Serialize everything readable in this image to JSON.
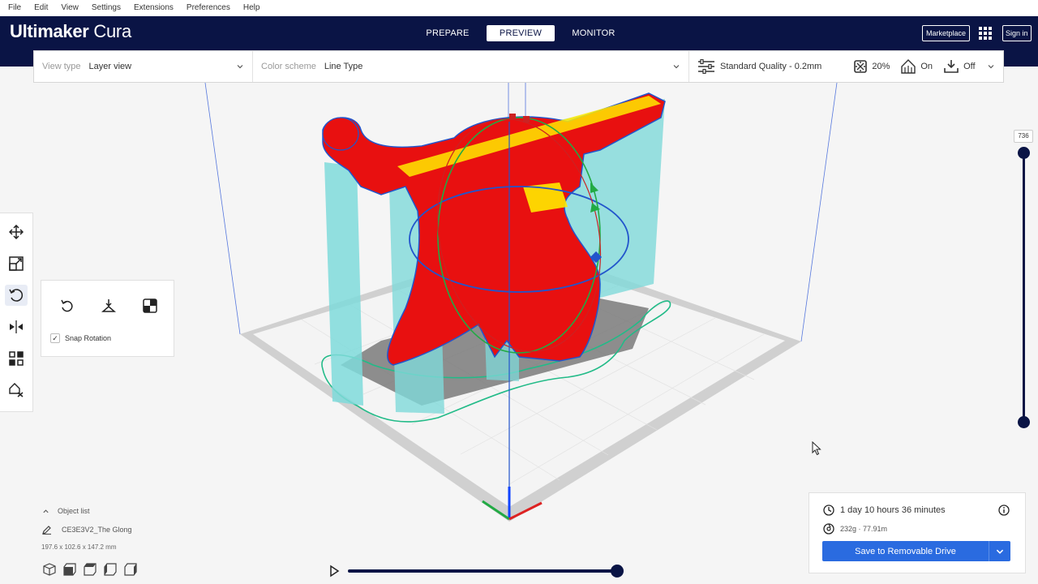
{
  "menu": {
    "items": [
      "File",
      "Edit",
      "View",
      "Settings",
      "Extensions",
      "Preferences",
      "Help"
    ]
  },
  "header": {
    "logo_brand": "Ultimaker",
    "logo_product": "Cura",
    "tabs": [
      {
        "label": "PREPARE",
        "active": false
      },
      {
        "label": "PREVIEW",
        "active": true
      },
      {
        "label": "MONITOR",
        "active": false
      }
    ],
    "marketplace_label": "Marketplace",
    "signin_label": "Sign in"
  },
  "viewbar": {
    "view_type_label": "View type",
    "view_type_value": "Layer view",
    "color_scheme_label": "Color scheme",
    "color_scheme_value": "Line Type",
    "profile": "Standard Quality - 0.2mm",
    "infill": "20%",
    "support": "On",
    "adhesion": "Off"
  },
  "toolbar": {
    "tools": [
      "move-icon",
      "scale-icon",
      "rotate-icon",
      "mirror-icon",
      "per-model-settings-icon",
      "support-blocker-icon"
    ],
    "active_tool": "rotate-icon"
  },
  "rotate_panel": {
    "snap_label": "Snap Rotation",
    "snap_checked": true
  },
  "layer_slider": {
    "current_layer": "736"
  },
  "object_list": {
    "header": "Object list",
    "object_name": "CE3E3V2_The Glong",
    "dimensions": "197.6 x 102.6 x 147.2 mm"
  },
  "output": {
    "print_time": "1 day 10 hours 36 minutes",
    "material": "232g · 77.91m",
    "save_label": "Save to Removable Drive"
  },
  "colors": {
    "header_bg": "#0a1445",
    "accent": "#2a6be0",
    "model_wall": "#e81010",
    "support": "#7fdada",
    "infill_yellow": "#ffea00"
  }
}
